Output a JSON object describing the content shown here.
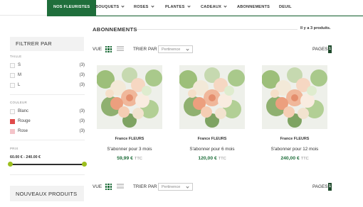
{
  "nav": {
    "items": [
      {
        "label": "NOS FLEURISTES",
        "active": true
      },
      {
        "label": "BOUQUETS",
        "dropdown": true
      },
      {
        "label": "ROSES",
        "dropdown": true
      },
      {
        "label": "PLANTES",
        "dropdown": true
      },
      {
        "label": "CADEAUX",
        "dropdown": true
      },
      {
        "label": "ABONNEMENTS",
        "dropdown": false
      },
      {
        "label": "DEUIL",
        "dropdown": false
      }
    ]
  },
  "sidebar": {
    "filter_title": "FILTRER PAR",
    "size_label": "TAILLE",
    "sizes": [
      {
        "label": "S",
        "count": "(3)"
      },
      {
        "label": "M",
        "count": "(3)"
      },
      {
        "label": "L",
        "count": "(3)"
      }
    ],
    "color_label": "COULEUR",
    "colors": [
      {
        "label": "Blanc",
        "count": "(3)",
        "swatch": "#ffffff"
      },
      {
        "label": "Rouge",
        "count": "(3)",
        "swatch": "#e04a4a"
      },
      {
        "label": "Rose",
        "count": "(3)",
        "swatch": "#f4c4c9"
      }
    ],
    "price_label": "PRIX",
    "price_range": "60.00 € - 240.00 €",
    "new_products_title": "NOUVEAUX PRODUITS"
  },
  "main": {
    "title": "ABONNEMENTS",
    "product_count": "Il y a 3 produits.",
    "view_label": "VUE",
    "sort_label": "TRIER PAR",
    "sort_placeholder": "Pertinence",
    "pages_label": "PAGES",
    "current_page": "1",
    "products": [
      {
        "brand": "France FLEURS",
        "name": "S'abonner pour 3 mois",
        "price": "59,99 €",
        "tax": "TTC"
      },
      {
        "brand": "France FLEURS",
        "name": "S'abonner pour 6 mois",
        "price": "120,00 €",
        "tax": "TTC"
      },
      {
        "brand": "France FLEURS",
        "name": "S'abonner pour 12 mois",
        "price": "240,00 €",
        "tax": "TTC"
      }
    ]
  },
  "colors": {
    "brand_green": "#1f6e3b",
    "slider_knob": "#9cbf1f",
    "page_badge": "#1f4a2c"
  }
}
